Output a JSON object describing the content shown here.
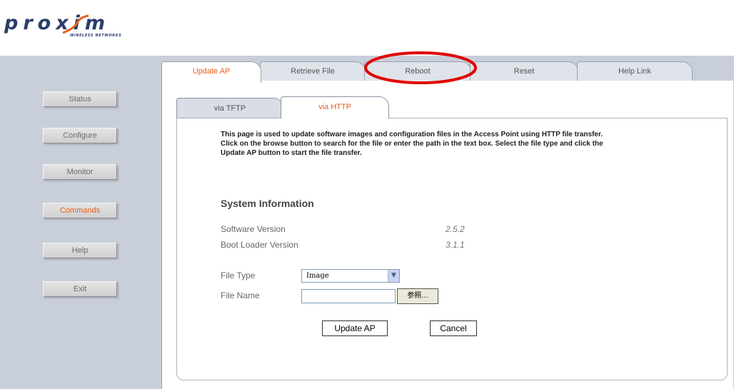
{
  "brand": {
    "logo_text": "proxim",
    "tagline": "WIRELESS NETWORKS"
  },
  "sidebar": {
    "items": [
      {
        "label": "Status",
        "active": false
      },
      {
        "label": "Configure",
        "active": false
      },
      {
        "label": "Monitor",
        "active": false
      },
      {
        "label": "Commands",
        "active": true
      },
      {
        "label": "Help",
        "active": false
      },
      {
        "label": "Exit",
        "active": false
      }
    ]
  },
  "tabs": [
    {
      "label": "Update AP",
      "active": true
    },
    {
      "label": "Retrieve File",
      "active": false
    },
    {
      "label": "Reboot",
      "active": false,
      "highlighted": true
    },
    {
      "label": "Reset",
      "active": false
    },
    {
      "label": "Help Link",
      "active": false
    }
  ],
  "subtabs": [
    {
      "label": "via TFTP",
      "active": false
    },
    {
      "label": "via HTTP",
      "active": true
    }
  ],
  "description": "This page is used to update software images and configuration files in the Access Point using HTTP file transfer. Click on the browse button to search for the file or enter the path in the text box. Select the file type and click the Update AP button to start the file transfer.",
  "system_info": {
    "title": "System Information",
    "software_version_label": "Software Version",
    "software_version": "2.5.2",
    "boot_loader_label": "Boot Loader Version",
    "boot_loader_version": "3.1.1"
  },
  "form": {
    "file_type_label": "File Type",
    "file_type_value": "Image",
    "file_name_label": "File Name",
    "file_name_value": "",
    "browse_label": "参照...",
    "update_label": "Update AP",
    "cancel_label": "Cancel"
  },
  "colors": {
    "accent": "#e8601c",
    "annotation": "#e00000",
    "sidebar_bg": "#c9cfda",
    "logo": "#2a3d6b"
  }
}
